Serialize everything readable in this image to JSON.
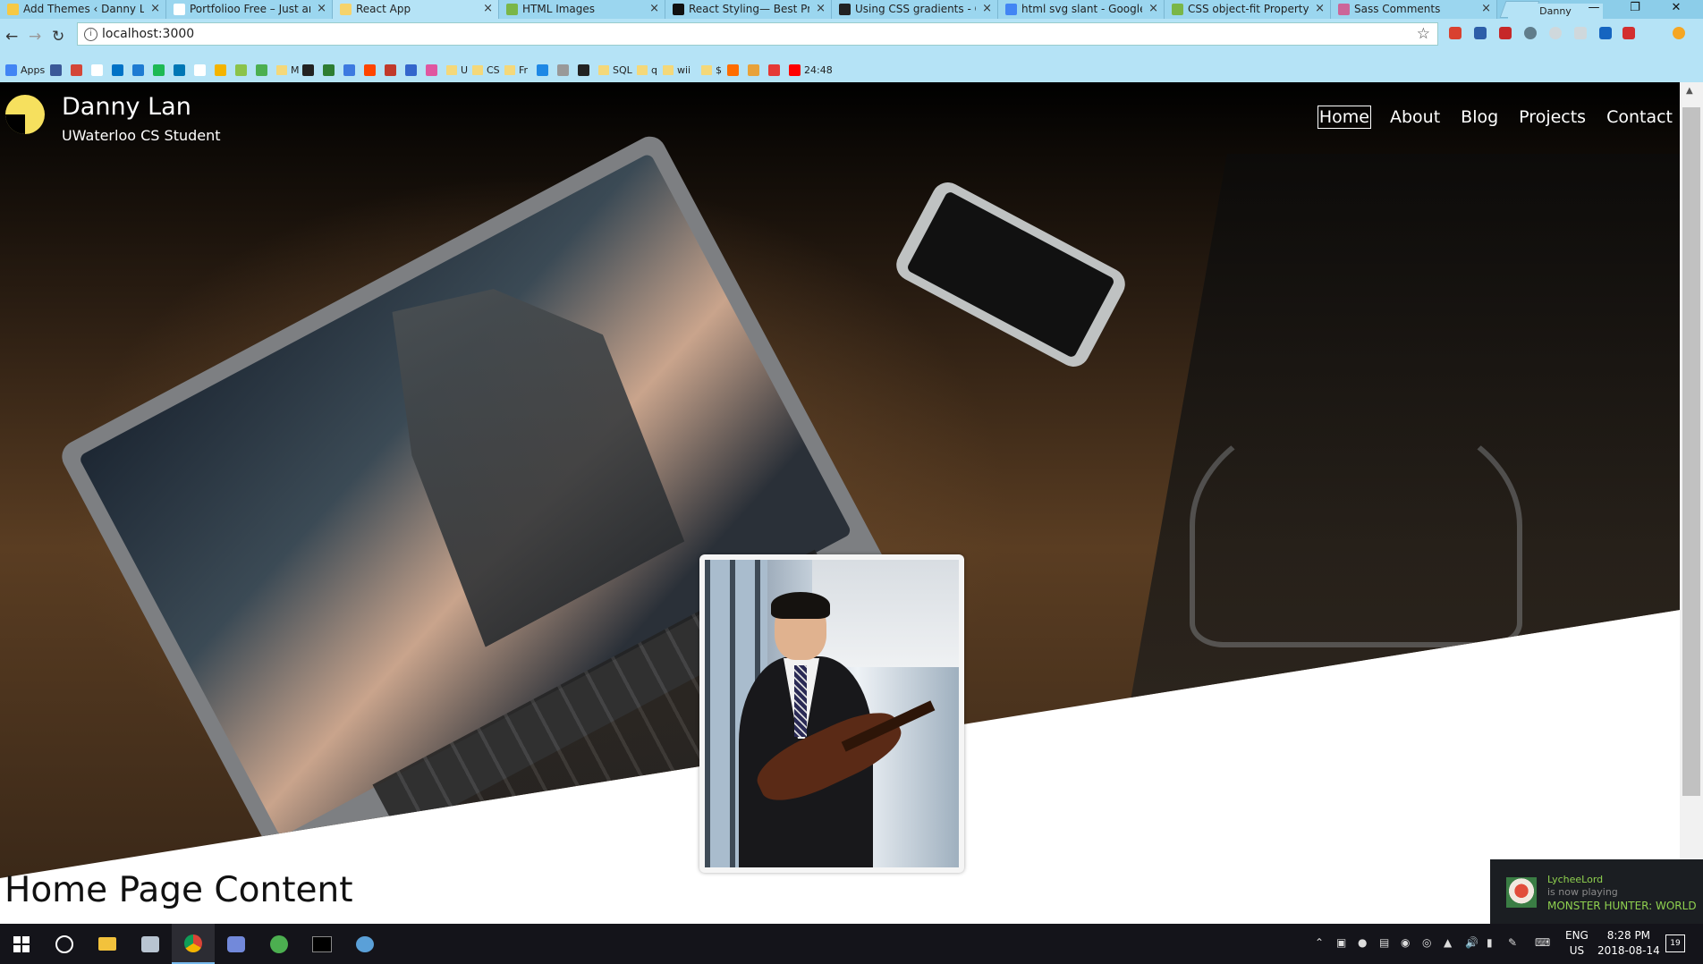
{
  "browser": {
    "tabs": [
      {
        "title": "Add Themes ‹ Danny La",
        "favicon_color": "#f6c945",
        "active": false
      },
      {
        "title": "Portfolioo Free – Just ar",
        "favicon_color": "#ffffff",
        "active": false
      },
      {
        "title": "React App",
        "favicon_color": "#f6d36b",
        "active": true
      },
      {
        "title": "HTML Images",
        "favicon_color": "#7ab648",
        "active": false
      },
      {
        "title": "React Styling— Best Pra",
        "favicon_color": "#111111",
        "active": false
      },
      {
        "title": "Using CSS gradients - C",
        "favicon_color": "#222222",
        "active": false
      },
      {
        "title": "html svg slant - Google",
        "favicon_color": "#4285f4",
        "active": false
      },
      {
        "title": "CSS object-fit Property",
        "favicon_color": "#7ab648",
        "active": false
      },
      {
        "title": "Sass Comments",
        "favicon_color": "#cc6699",
        "active": false
      }
    ],
    "close_glyph": "×",
    "profile_name": "Danny",
    "window_controls": {
      "minimize": "—",
      "restore": "❐",
      "close": "✕"
    },
    "url": "localhost:3000",
    "bookmarks": [
      {
        "label": "Apps",
        "icon": "apps-grid-icon",
        "color": "#4285f4"
      },
      {
        "label": "",
        "icon": "facebook-icon",
        "color": "#3b5998"
      },
      {
        "label": "",
        "icon": "gmail-icon",
        "color": "#d44638"
      },
      {
        "label": "",
        "icon": "page-icon",
        "color": "#ffffff"
      },
      {
        "label": "",
        "icon": "outlook-icon",
        "color": "#0072c6"
      },
      {
        "label": "",
        "icon": "edge-icon",
        "color": "#1e7bd2"
      },
      {
        "label": "",
        "icon": "spotify-icon",
        "color": "#1db954"
      },
      {
        "label": "",
        "icon": "linkedin-icon",
        "color": "#0077b5"
      },
      {
        "label": "",
        "icon": "page-icon",
        "color": "#ffffff"
      },
      {
        "label": "",
        "icon": "drive-icon",
        "color": "#f4b400"
      },
      {
        "label": "",
        "icon": "globe-icon",
        "color": "#8bc34a"
      },
      {
        "label": "",
        "icon": "image-icon",
        "color": "#4caf50"
      },
      {
        "label": "M",
        "icon": "folder-icon",
        "color": "#f4d87a"
      },
      {
        "label": "",
        "icon": "github-icon",
        "color": "#222222"
      },
      {
        "label": "",
        "icon": "matrix-icon",
        "color": "#2e7d32"
      },
      {
        "label": "",
        "icon": "w-icon",
        "color": "#3d7ae0"
      },
      {
        "label": "",
        "icon": "reddit-icon",
        "color": "#ff4500"
      },
      {
        "label": "",
        "icon": "flag-icon",
        "color": "#c0392b"
      },
      {
        "label": "",
        "icon": "stack-icon",
        "color": "#3366cc"
      },
      {
        "label": "",
        "icon": "dots-icon",
        "color": "#e056a0"
      },
      {
        "label": "U",
        "icon": "folder-icon",
        "color": "#f4d87a"
      },
      {
        "label": "CS",
        "icon": "folder-icon",
        "color": "#f4d87a"
      },
      {
        "label": "Fr",
        "icon": "folder-icon",
        "color": "#f4d87a"
      },
      {
        "label": "",
        "icon": "c-icon",
        "color": "#1e88e5"
      },
      {
        "label": "",
        "icon": "grid-icon",
        "color": "#999999"
      },
      {
        "label": "",
        "icon": "amazon-icon",
        "color": "#222222"
      },
      {
        "label": "SQL",
        "icon": "folder-icon",
        "color": "#f4d87a"
      },
      {
        "label": "q",
        "icon": "folder-icon",
        "color": "#f4d87a"
      },
      {
        "label": "wii",
        "icon": "folder-icon",
        "color": "#f4d87a"
      },
      {
        "label": "$",
        "icon": "folder-icon",
        "color": "#f4d87a"
      },
      {
        "label": "",
        "icon": "music-icon",
        "color": "#ff6d00"
      },
      {
        "label": "",
        "icon": "g-icon",
        "color": "#e8a23a"
      },
      {
        "label": "",
        "icon": "bug-icon",
        "color": "#e53935"
      },
      {
        "label": "24:48",
        "icon": "youtube-icon",
        "color": "#ff0000"
      }
    ]
  },
  "site": {
    "brand_name": "Danny Lan",
    "brand_subtitle": "UWaterloo CS Student",
    "nav": [
      {
        "label": "Home",
        "active": true
      },
      {
        "label": "About",
        "active": false
      },
      {
        "label": "Blog",
        "active": false
      },
      {
        "label": "Projects",
        "active": false
      },
      {
        "label": "Contact",
        "active": false
      }
    ],
    "content_title": "Home Page Content",
    "accent_color": "#f6e05e"
  },
  "steam_notification": {
    "user": "LycheeLord",
    "status": "is now playing",
    "game": "MONSTER HUNTER: WORLD"
  },
  "taskbar": {
    "language_line1": "ENG",
    "language_line2": "US",
    "time": "8:28 PM",
    "date": "2018-08-14",
    "notification_count": "19"
  }
}
